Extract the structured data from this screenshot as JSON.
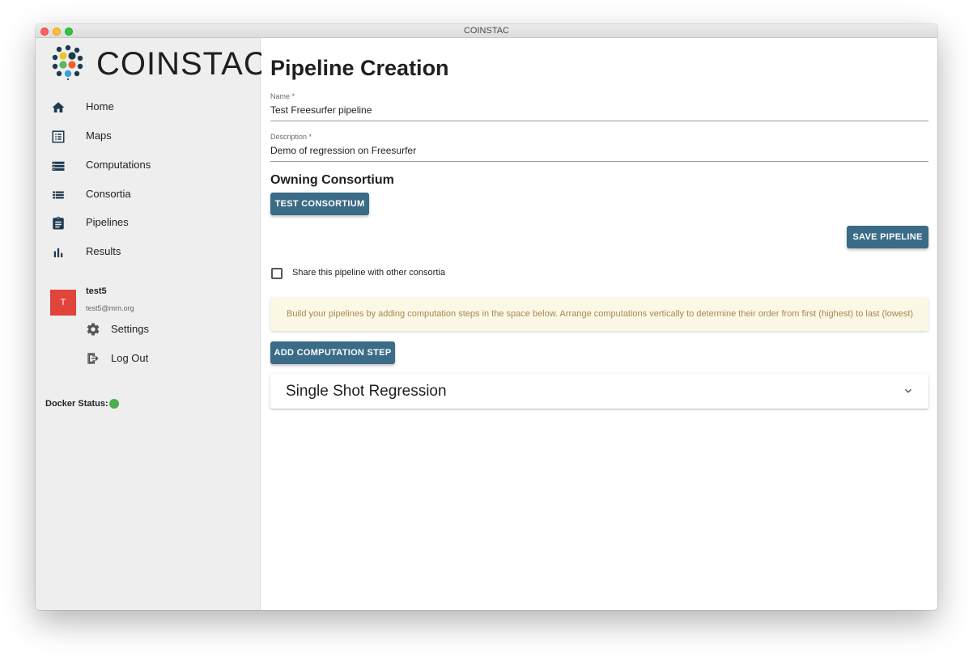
{
  "window": {
    "title": "COINSTAC"
  },
  "brand": {
    "name": "COINSTAC"
  },
  "sidebar": {
    "items": [
      {
        "label": "Home",
        "icon": "home-icon"
      },
      {
        "label": "Maps",
        "icon": "maps-icon"
      },
      {
        "label": "Computations",
        "icon": "computations-icon"
      },
      {
        "label": "Consortia",
        "icon": "consortia-icon"
      },
      {
        "label": "Pipelines",
        "icon": "pipelines-icon"
      },
      {
        "label": "Results",
        "icon": "results-icon"
      }
    ],
    "user": {
      "initial": "T",
      "name": "test5",
      "email": "test5@mrn.org",
      "avatar_color": "#e0443b"
    },
    "user_menu": [
      {
        "label": "Settings",
        "icon": "gear-icon"
      },
      {
        "label": "Log Out",
        "icon": "logout-icon"
      }
    ],
    "docker": {
      "label": "Docker Status:",
      "status_color": "#4caf50"
    }
  },
  "main": {
    "title": "Pipeline Creation",
    "name_field": {
      "label": "Name *",
      "value": "Test Freesurfer pipeline"
    },
    "description_field": {
      "label": "Description *",
      "value": "Demo of regression on Freesurfer"
    },
    "owning_consortium": {
      "title": "Owning Consortium",
      "button_label": "Test Consortium"
    },
    "save_button_label": "Save Pipeline",
    "share_checkbox": {
      "label": "Share this pipeline with other consortia",
      "checked": false
    },
    "notice": "Build your pipelines by adding computation steps in the space below. Arrange computations vertically to determine their order from first (highest) to last (lowest)",
    "add_step_button_label": "Add Computation Step",
    "steps": [
      {
        "title": "Single Shot Regression",
        "icon": "chevron-down-icon"
      }
    ]
  },
  "colors": {
    "primary_button": "#3a6b87",
    "sidebar_bg": "#eeeeee",
    "notice_bg": "#fcf8e6",
    "notice_text": "#a5894d",
    "nav_icon": "#1e3a4f"
  }
}
